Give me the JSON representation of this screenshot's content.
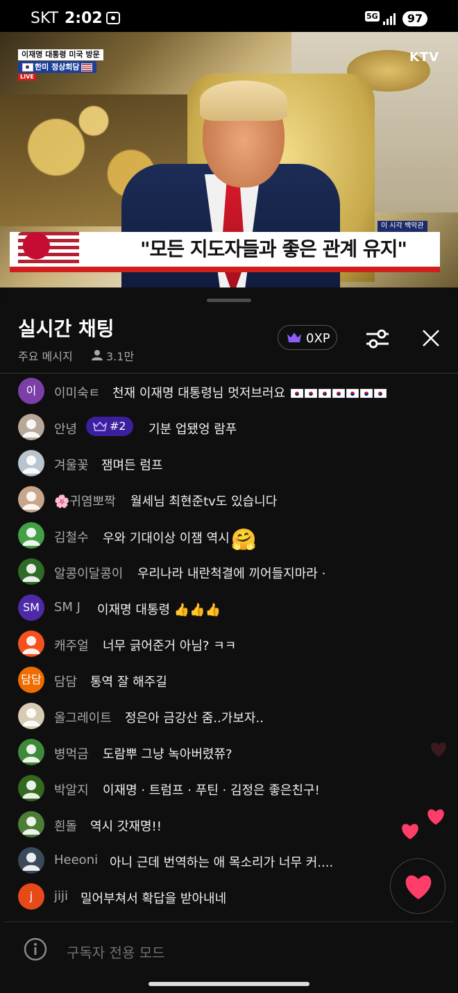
{
  "status_bar": {
    "carrier": "SKT",
    "time": "2:02",
    "network": "5G",
    "battery": "97"
  },
  "video": {
    "topic_line1": "이재명 대통령 미국 방문",
    "topic_line2": "한미 정상회담",
    "live": "LIVE",
    "channel": "KTV",
    "now_label": "이 시각 백악관",
    "headline": "\"모든 지도자들과 좋은 관계 유지\""
  },
  "chat": {
    "title": "실시간 채팅",
    "xp_label": "0XP",
    "mode_label": "주요 메시지",
    "viewer_count": "3.1만",
    "messages": [
      {
        "author": "이미숙ㅌ",
        "avatar_text": "이",
        "avatar_color": "#7b3fa7",
        "text": "천재 이재명 대통령님 멋저브러요",
        "flags": 7
      },
      {
        "author": "안녕",
        "avatar_color": "#b8a89a",
        "badge": "#2",
        "text": "기분 업됐엉 람푸"
      },
      {
        "author": "겨울꽃",
        "avatar_color": "#b9c4cf",
        "text": "잼며든 럼프"
      },
      {
        "author": "🌸귀염뽀짝",
        "avatar_color": "#c9a58a",
        "text": "월세님 최현준tv도 있습니다"
      },
      {
        "author": "김철수",
        "avatar_color": "#43a047",
        "text": "우와 기대이상 이잼 역시",
        "emoji": "🤗"
      },
      {
        "author": "알콩이달콩이",
        "avatar_color": "#2e6b26",
        "text": "우리나라 내란척결에 끼어들지마라 ·"
      },
      {
        "author": "SM J",
        "avatar_text": "SM",
        "avatar_color": "#4e2aa8",
        "text": "이재명 대통령 👍👍👍"
      },
      {
        "author": "캐주얼",
        "avatar_color": "#f4511e",
        "text": "너무 긁어준거 아님? ㅋㅋ"
      },
      {
        "author": "담담",
        "avatar_text": "담담",
        "avatar_color": "#ef6c00",
        "text": "통역 잘 해주길"
      },
      {
        "author": "올그레이트",
        "avatar_color": "#d7cbb4",
        "text": "정은아 금강산 줌..가보자.."
      },
      {
        "author": "병먹금",
        "avatar_color": "#3d8a3a",
        "text": "도람뿌 그냥 녹아버렸쮸?"
      },
      {
        "author": "박알지",
        "avatar_color": "#33691e",
        "text": "이재명 · 트럼프 · 푸틴 · 김정은 좋은친구!"
      },
      {
        "author": "흰돌",
        "avatar_color": "#4b7d36",
        "text": "역시 갓재명!!"
      },
      {
        "author": "Heeoni",
        "avatar_color": "#3a4a5a",
        "text": "아니 근데 번역하는 애 목소리가 너무 커...."
      },
      {
        "author": "jiji",
        "avatar_text": "j",
        "avatar_color": "#e64a19",
        "text": "밀어부쳐서 확답을 받아내네"
      }
    ],
    "input_placeholder": "구독자 전용 모드"
  },
  "colors": {
    "accent_purple": "#3b1f9c",
    "heart": "#ff3d6b",
    "live_red": "#d31c1c"
  }
}
